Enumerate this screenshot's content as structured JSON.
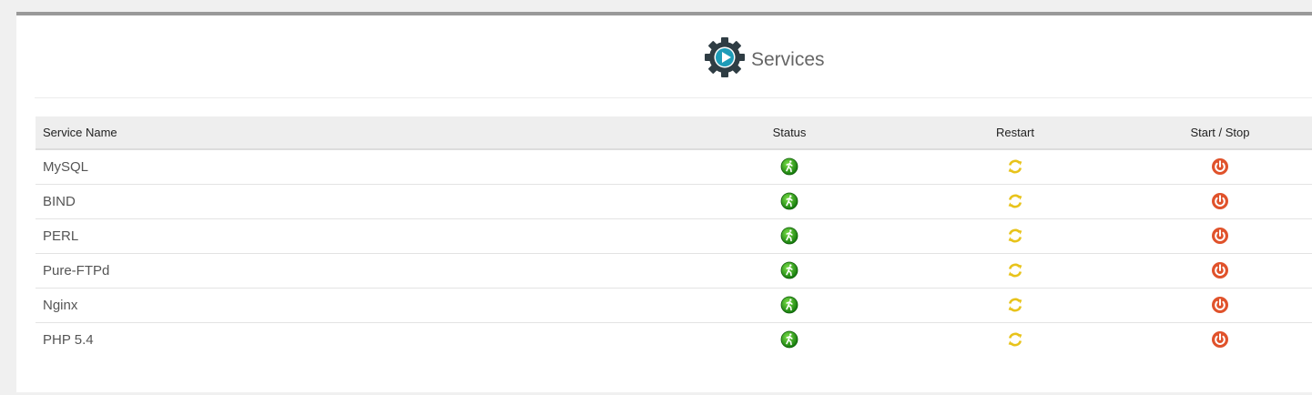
{
  "page": {
    "title": "Services",
    "title_icon": "gear-play-icon"
  },
  "table": {
    "headers": {
      "name": "Service Name",
      "status": "Status",
      "restart": "Restart",
      "start_stop": "Start / Stop"
    },
    "rows": [
      {
        "name": "MySQL",
        "status_icon": "running-status-icon",
        "restart_icon": "restart-icon",
        "power_icon": "power-icon"
      },
      {
        "name": "BIND",
        "status_icon": "running-status-icon",
        "restart_icon": "restart-icon",
        "power_icon": "power-icon"
      },
      {
        "name": "PERL",
        "status_icon": "running-status-icon",
        "restart_icon": "restart-icon",
        "power_icon": "power-icon"
      },
      {
        "name": "Pure-FTPd",
        "status_icon": "running-status-icon",
        "restart_icon": "restart-icon",
        "power_icon": "power-icon"
      },
      {
        "name": "Nginx",
        "status_icon": "running-status-icon",
        "restart_icon": "restart-icon",
        "power_icon": "power-icon"
      },
      {
        "name": "PHP 5.4",
        "status_icon": "running-status-icon",
        "restart_icon": "restart-icon",
        "power_icon": "power-icon"
      }
    ]
  },
  "colors": {
    "status_green": "#22a312",
    "restart_yellow": "#e8c31a",
    "power_red": "#e0522b",
    "gear_dark": "#2f3d44",
    "play_teal": "#1e9cb8"
  }
}
